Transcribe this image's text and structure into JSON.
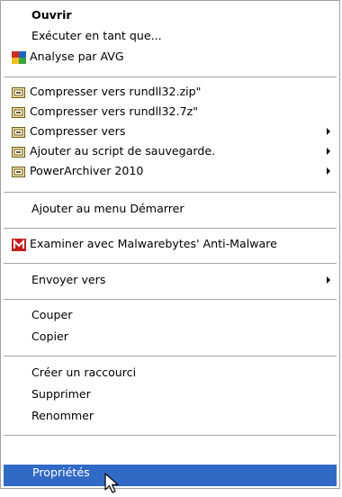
{
  "menu": {
    "items": [
      {
        "label": "Ouvrir"
      },
      {
        "label": "Exécuter en tant que..."
      },
      {
        "label": "Analyse par AVG",
        "icon": "avg-icon"
      },
      {
        "label": "Compresser vers rundll32.zip\"",
        "icon": "powerarchiver-icon"
      },
      {
        "label": "Compresser vers rundll32.7z\"",
        "icon": "powerarchiver-icon"
      },
      {
        "label": "Compresser vers",
        "icon": "powerarchiver-icon",
        "submenu": true
      },
      {
        "label": "Ajouter au script de sauvegarde.",
        "icon": "powerarchiver-icon",
        "submenu": true
      },
      {
        "label": "PowerArchiver 2010",
        "icon": "powerarchiver-icon",
        "submenu": true
      },
      {
        "label": "Ajouter au menu Démarrer"
      },
      {
        "label": "Examiner avec Malwarebytes' Anti-Malware",
        "icon": "malwarebytes-icon"
      },
      {
        "label": "Envoyer vers",
        "submenu": true
      },
      {
        "label": "Couper"
      },
      {
        "label": "Copier"
      },
      {
        "label": "Créer un raccourci"
      },
      {
        "label": "Supprimer"
      },
      {
        "label": "Renommer"
      },
      {
        "label": "Propriétés"
      }
    ]
  },
  "colors": {
    "selection": "#316ac5",
    "separator": "#a7a6aa",
    "avg_red": "#d32a1e",
    "avg_blue": "#1f5fbf",
    "avg_green": "#3aa53a",
    "avg_yellow": "#f0c020",
    "malwarebytes_red": "#c41e1e"
  }
}
